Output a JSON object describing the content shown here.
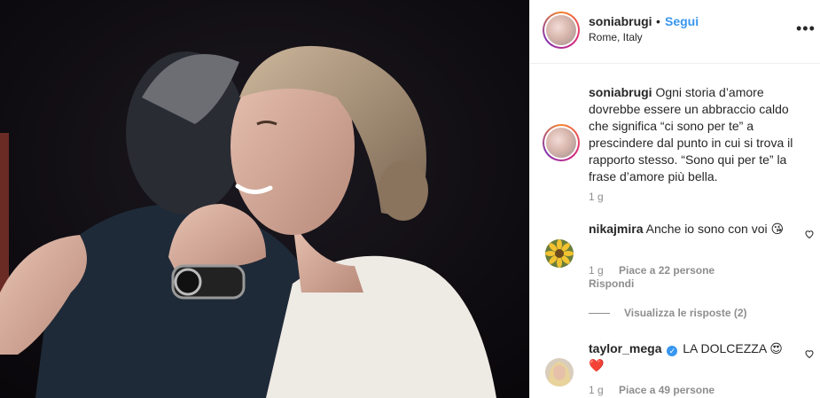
{
  "post": {
    "image_alt": "",
    "owner": {
      "username": "soniabrugi",
      "separator": "•",
      "follow_label": "Segui",
      "location": "Rome, Italy",
      "more_icon": "more-options-icon"
    },
    "caption": {
      "username": "soniabrugi",
      "text": "Ogni storia d’amore dovrebbe essere un abbraccio caldo che significa “ci sono per te” a prescindere dal punto in cui si trova il rapporto stesso. “Sono qui per te” la frase d’amore più bella.",
      "time": "1 g"
    },
    "comments": [
      {
        "username": "nikajmira",
        "text": "Anche io sono con voi 😘",
        "time": "1 g",
        "likes": "Piace a 22 persone",
        "reply_label": "Rispondi",
        "view_replies": "Visualizza le risposte (2)",
        "avatar_icon": "sunflower-avatar-icon"
      },
      {
        "username": "taylor_mega",
        "verified": true,
        "text": "LA DOLCEZZA 😍 ❤️",
        "time": "1 g",
        "likes": "Piace a 49 persone",
        "avatar_icon": "blonde-avatar-icon"
      }
    ]
  },
  "colors": {
    "link_blue": "#3897f0",
    "muted": "#8e8e8e",
    "text": "#262626",
    "border": "#efefef"
  }
}
